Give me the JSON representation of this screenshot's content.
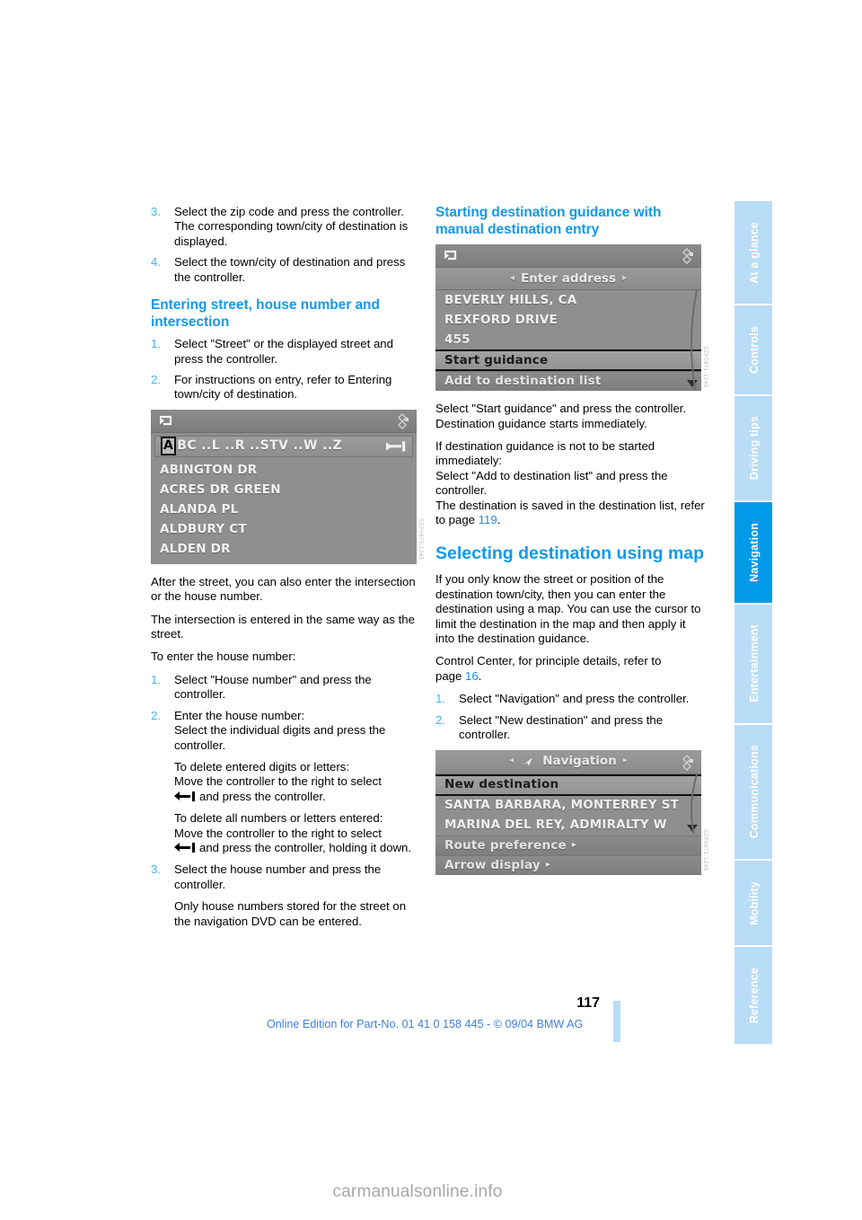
{
  "document": {
    "page_number": "117",
    "footer_note": "Online Edition for Part-No. 01 41 0 158 445 - © 09/04 BMW AG",
    "watermark": "carmanualsonline.info",
    "accent_color": "#0d9aef",
    "tab_active_color": "#009ae8",
    "tab_inactive_color": "#b9dcf7"
  },
  "tabs": [
    {
      "label": "At a glance",
      "active": false
    },
    {
      "label": "Controls",
      "active": false
    },
    {
      "label": "Driving tips",
      "active": false
    },
    {
      "label": "Navigation",
      "active": true
    },
    {
      "label": "Entertainment",
      "active": false
    },
    {
      "label": "Communications",
      "active": false
    },
    {
      "label": "Mobility",
      "active": false
    },
    {
      "label": "Reference",
      "active": false
    }
  ],
  "left_column": {
    "steps_top": [
      {
        "num": "3.",
        "text": "Select the zip code and press the controller.",
        "sub": "The corresponding town/city of destination is displayed."
      },
      {
        "num": "4.",
        "text": "Select the town/city of destination and press the controller.",
        "sub": ""
      }
    ],
    "heading_street": "Entering street, house number and intersection",
    "steps_street": [
      {
        "num": "1.",
        "text": "Select \"Street\" or the displayed street and press the controller.",
        "sub": ""
      },
      {
        "num": "2.",
        "text": "For instructions on entry, refer to Entering town/city of destination.",
        "sub": ""
      }
    ],
    "screenshot_street": {
      "image_code": "SZP0870-1245",
      "input_letters_cursor": "A",
      "input_letters_rest": "BC ..L ..R ..STV ..W ..Z",
      "list": [
        "ABINGTON DR",
        "ACRES DR GREEN",
        "ALANDA PL",
        "ALDBURY CT",
        "ALDEN DR"
      ]
    },
    "paras_after_shot": [
      "After the street, you can also enter the intersection or the house number.",
      "The intersection is entered in the same way as the street.",
      "To enter the house number:"
    ],
    "steps_house": [
      {
        "num": "1.",
        "text": "Select \"House number\" and press the controller."
      },
      {
        "num": "2.",
        "text": "Enter the house number:"
      }
    ],
    "house_sub_lines": [
      "Select the individual digits and press the controller.",
      "To delete entered digits or letters:",
      "Move the controller to the right to select",
      "and press the controller.",
      "To delete all numbers or letters entered:",
      "Move the controller to the right to select",
      "and press the controller, holding it down."
    ],
    "step_house_3": {
      "num": "3.",
      "text": "Select the house number and press the controller."
    },
    "closing_note": "Only house numbers stored for the street on the navigation DVD can be entered."
  },
  "right_column": {
    "heading_start_guidance": "Starting destination guidance with manual destination entry",
    "screenshot_address": {
      "image_code": "SZP0871-1245",
      "title": "Enter address",
      "list": [
        "BEVERLY HILLS, CA",
        "REXFORD DRIVE",
        "455"
      ],
      "selected_item": "Start guidance",
      "footer_item": "Add to destination list"
    },
    "paras_start": [
      "Select \"Start guidance\" and press the controller.",
      "Destination guidance starts immediately."
    ],
    "paras_delay_part1": "If destination guidance is not to be started immediately:",
    "paras_delay_part2": "Select \"Add to destination list\" and press the controller.",
    "paras_delay_part3_pre": "The destination is saved in the destination list, refer to page",
    "paras_delay_page_ref": "119",
    "heading_map": "Selecting destination using map",
    "paras_map": [
      " If you only know the street or position of the destination town/city, then you can enter the destination using a map. You can use the cursor to limit the destination in the map and then apply it into the destination guidance."
    ],
    "control_center_pre": "Control Center, for principle details, refer to page",
    "control_center_page_ref": "16",
    "steps_map": [
      {
        "num": "1.",
        "text": "Select \"Navigation\" and press the controller."
      },
      {
        "num": "2.",
        "text": "Select \"New destination\" and press the controller."
      }
    ],
    "screenshot_navigation": {
      "image_code": "SZP0872-1245",
      "title": "Navigation",
      "selected_item": "New destination",
      "list": [
        "SANTA BARBARA, MONTERREY ST",
        "MARINA DEL REY, ADMIRALTY W"
      ],
      "footer_items": [
        "Route preference",
        "Arrow display"
      ]
    }
  }
}
